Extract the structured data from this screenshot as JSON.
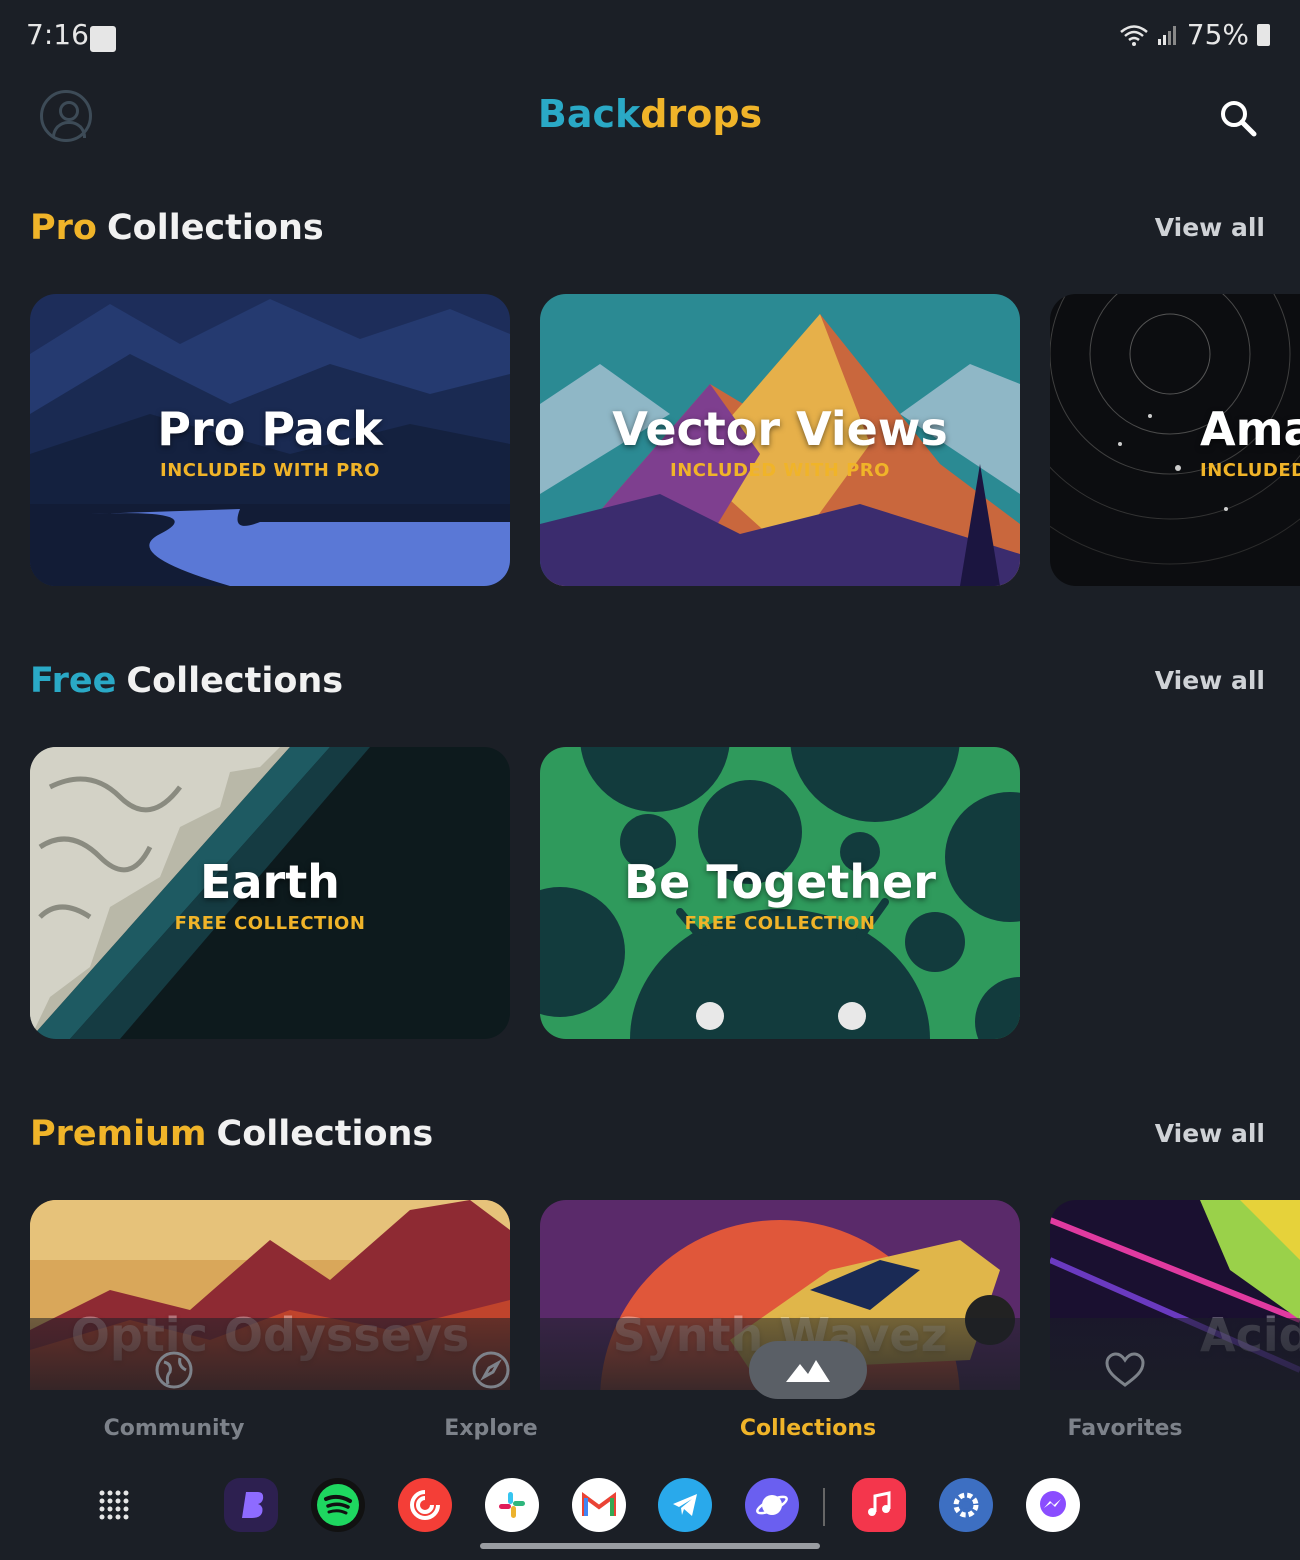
{
  "status_bar": {
    "time": "7:16",
    "battery": "75%"
  },
  "header": {
    "title_part1": "Back",
    "title_part2": "drops"
  },
  "sections": [
    {
      "highlight": "Pro",
      "rest": "Collections",
      "highlight_color": "#f0b429",
      "view_all": "View all",
      "cards": [
        {
          "title": "Pro Pack",
          "subtitle": "INCLUDED WITH PRO"
        },
        {
          "title": "Vector Views",
          "subtitle": "INCLUDED WITH PRO"
        },
        {
          "title": "Ama",
          "subtitle": "INCLUDED W"
        }
      ]
    },
    {
      "highlight": "Free",
      "rest": "Collections",
      "highlight_color": "#2aa9c6",
      "view_all": "View all",
      "cards": [
        {
          "title": "Earth",
          "subtitle": "FREE COLLECTION"
        },
        {
          "title": "Be Together",
          "subtitle": "FREE COLLECTION"
        }
      ]
    },
    {
      "highlight": "Premium",
      "rest": "Collections",
      "highlight_color": "#f0b429",
      "view_all": "View all",
      "cards": [
        {
          "title": "Optic Odysseys"
        },
        {
          "title": "Synth Wavez"
        },
        {
          "title": "Acid"
        }
      ]
    }
  ],
  "bottom_nav": [
    {
      "label": "Community",
      "icon": "globe-icon"
    },
    {
      "label": "Explore",
      "icon": "compass-icon"
    },
    {
      "label": "Collections",
      "icon": "mountains-icon",
      "active": true
    },
    {
      "label": "Favorites",
      "icon": "heart-icon"
    }
  ],
  "dock": {
    "apps": [
      "app-drawer",
      "beeper",
      "spotify",
      "pocket-casts",
      "slack",
      "gmail",
      "telegram",
      "samsung-internet",
      "apple-music",
      "settings",
      "messenger"
    ]
  },
  "colors": {
    "accent_yellow": "#f0b429",
    "accent_teal": "#2aa9c6",
    "background": "#1b1f26"
  }
}
